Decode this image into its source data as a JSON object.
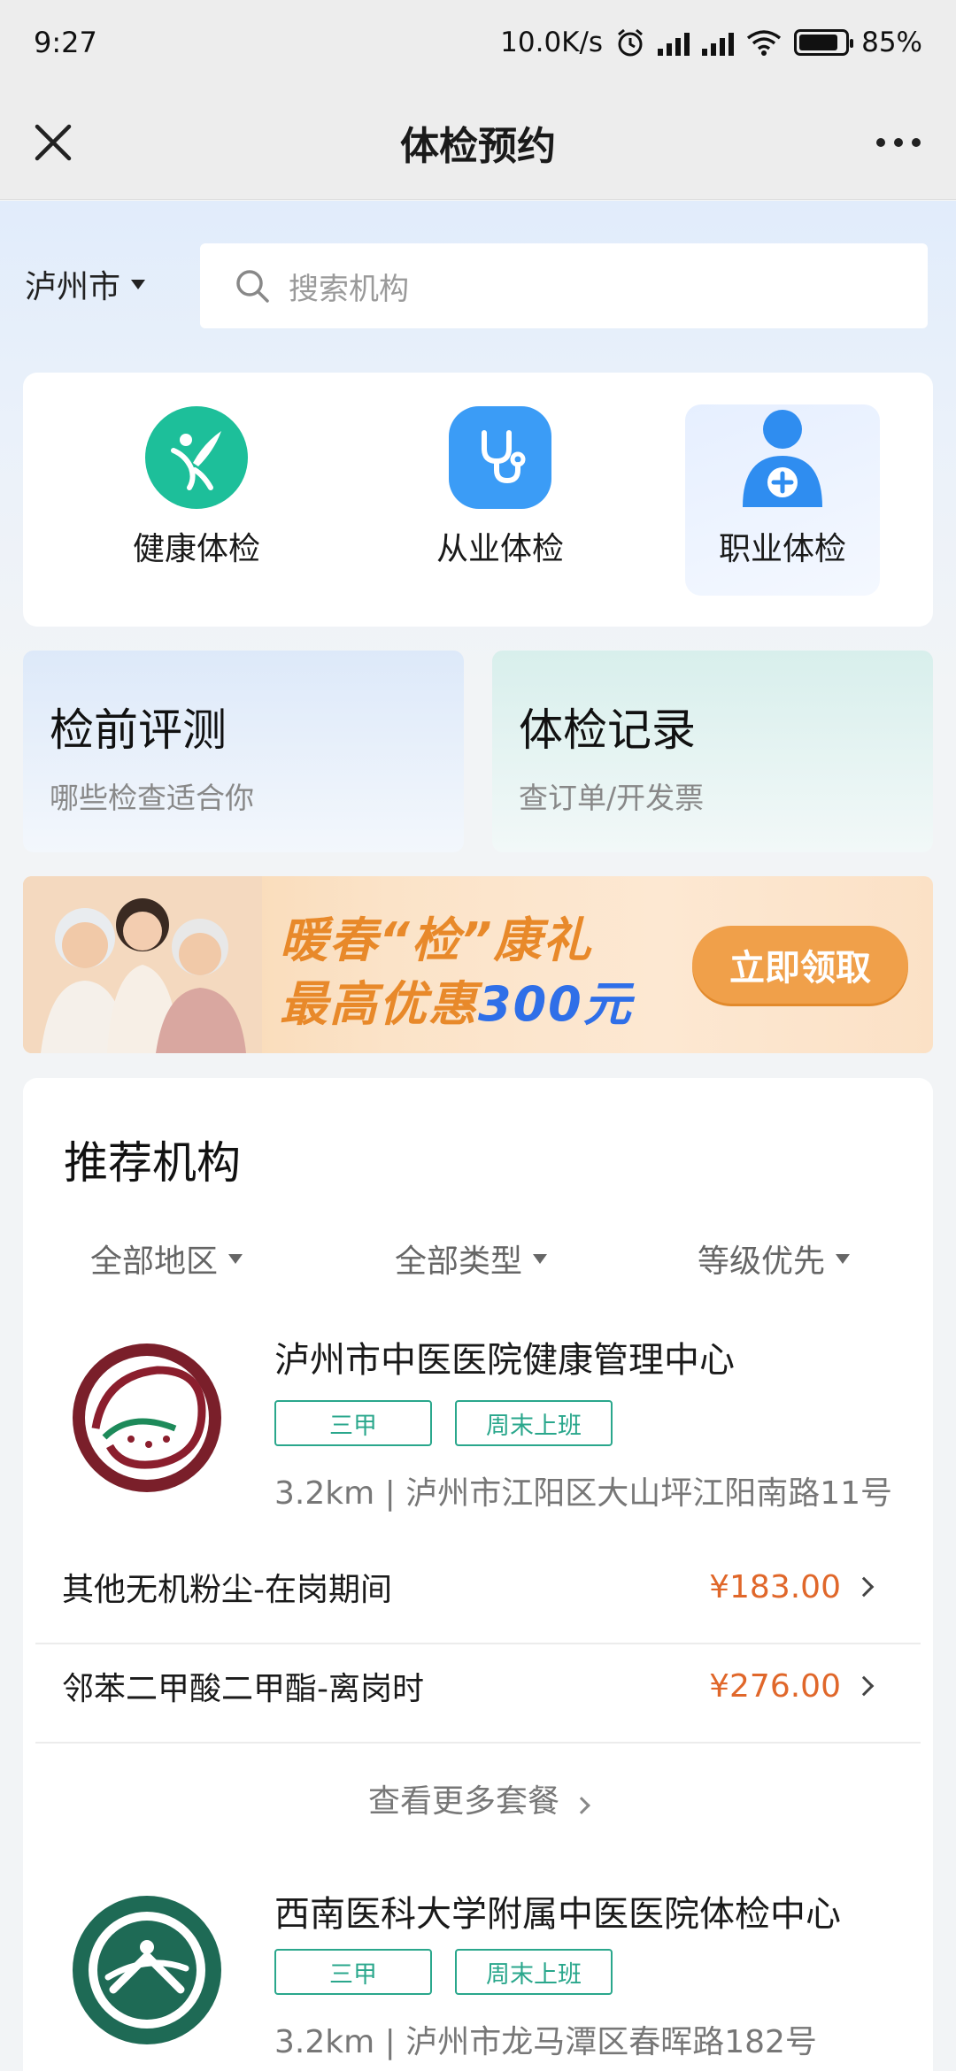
{
  "status_bar": {
    "time": "9:27",
    "network_speed": "10.0K/s",
    "battery": "85%",
    "battery_level": 0.85
  },
  "nav": {
    "title": "体检预约"
  },
  "location": {
    "city": "泸州市"
  },
  "search": {
    "placeholder": "搜索机构"
  },
  "categories": [
    {
      "label": "健康体检",
      "icon": "person-leaf-icon",
      "color": "#1dbf9a"
    },
    {
      "label": "从业体检",
      "icon": "stethoscope-icon",
      "color": "#3b9cf6"
    },
    {
      "label": "职业体检",
      "icon": "doctor-plus-icon",
      "color": "#2f8df0",
      "selected": true
    }
  ],
  "features": [
    {
      "title": "检前评测",
      "subtitle": "哪些检查适合你"
    },
    {
      "title": "体检记录",
      "subtitle": "查订单/开发票"
    }
  ],
  "banner": {
    "line1": "暖春“检”康礼",
    "line2_prefix": "最高优惠",
    "line2_amount": "300元",
    "button": "立即领取"
  },
  "recommend": {
    "title": "推荐机构",
    "filters": [
      "全部地区",
      "全部类型",
      "等级优先"
    ],
    "orgs": [
      {
        "name": "泸州市中医医院健康管理中心",
        "tags": [
          "三甲",
          "周末上班"
        ],
        "distance": "3.2km",
        "address": "泸州市江阳区大山坪江阳南路11号",
        "packages": [
          {
            "name": "其他无机粉尘-在岗期间",
            "price": "¥183.00"
          },
          {
            "name": "邻苯二甲酸二甲酯-离岗时",
            "price": "¥276.00"
          }
        ],
        "more": "查看更多套餐"
      },
      {
        "name": "西南医科大学附属中医医院体检中心",
        "tags": [
          "三甲",
          "周末上班"
        ],
        "distance": "3.2km",
        "address": "泸州市龙马潭区春晖路182号"
      }
    ]
  },
  "colors": {
    "accent_green": "#2aa78c",
    "price_orange": "#e0672a",
    "banner_orange": "#e8892a",
    "banner_blue": "#2f6fe8"
  }
}
